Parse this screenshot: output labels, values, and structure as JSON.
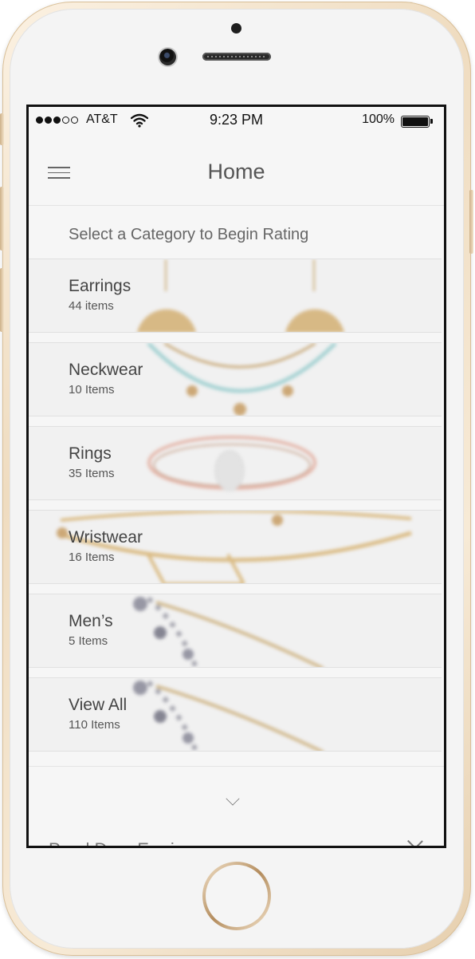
{
  "status_bar": {
    "carrier": "AT&T",
    "time": "9:23 PM",
    "battery": "100%"
  },
  "nav": {
    "title": "Home"
  },
  "prompt": "Select a Category to Begin Rating",
  "categories": [
    {
      "name": "Earrings",
      "count": "44 items"
    },
    {
      "name": "Neckwear",
      "count": "10 Items"
    },
    {
      "name": "Rings",
      "count": "35 Items"
    },
    {
      "name": "Wristwear",
      "count": "16 Items"
    },
    {
      "name": "Men’s",
      "count": "5 Items"
    },
    {
      "name": "View All",
      "count": "110 Items"
    }
  ],
  "peek": {
    "title": "Pearl Drop Earrings"
  },
  "colors": {
    "gold": "#d8b577",
    "rose": "#e3b0a2",
    "turquoise": "#9ecfd0",
    "background": "#f6f6f6"
  }
}
